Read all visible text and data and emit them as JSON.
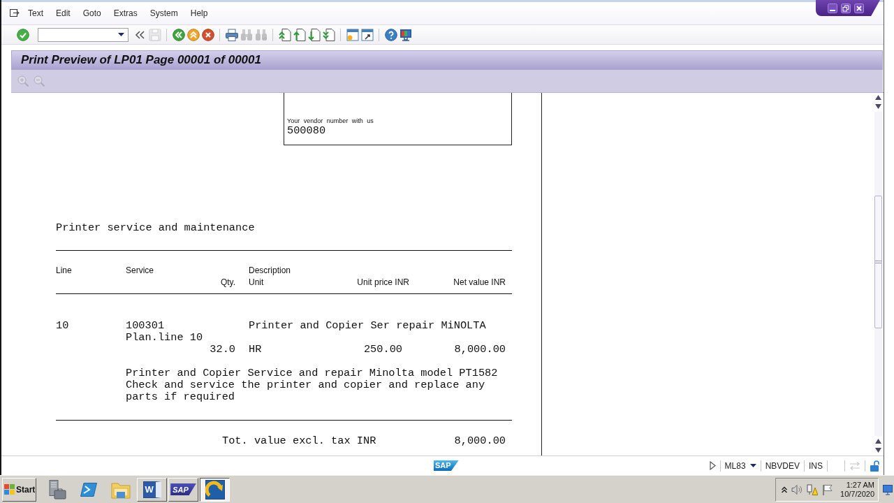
{
  "window": {
    "menu": [
      {
        "label": "Text"
      },
      {
        "label": "Edit"
      },
      {
        "label": "Goto"
      },
      {
        "label": "Extras"
      },
      {
        "label": "System"
      },
      {
        "label": "Help"
      }
    ]
  },
  "toolbar": {
    "buttons": [
      {
        "disabled": false
      },
      {
        "disabled": false
      },
      {
        "disabled": true
      },
      {
        "disabled": false
      },
      {
        "disabled": false
      },
      {
        "disabled": false
      },
      {
        "disabled": false
      },
      {
        "disabled": true
      },
      {
        "disabled": true
      },
      {
        "disabled": false
      },
      {
        "disabled": false
      },
      {
        "disabled": false
      },
      {
        "disabled": false
      },
      {
        "disabled": false
      },
      {
        "disabled": false
      },
      {
        "disabled": false
      },
      {
        "disabled": false
      }
    ]
  },
  "title": "Print Preview of LP01 Page 00001 of 00001",
  "application_toolbar": {
    "buttons": [
      {
        "disabled": true
      },
      {
        "disabled": true
      }
    ]
  },
  "document": {
    "vendor_box": {
      "label": "Your vendor number with us",
      "value": "500080"
    },
    "heading": "Printer service and maintenance",
    "header": {
      "line": "Line",
      "service": "Service",
      "description": "Description",
      "qty": "Qty.",
      "unit": "Unit",
      "unit_price": "Unit price INR",
      "net_value": "Net value INR"
    },
    "items": [
      {
        "line": "10",
        "service": "100301",
        "short_text": "Printer and Copier Ser repair MiNOLTA",
        "plan_line": "Plan.line 10",
        "qty": "32.0",
        "unit": "HR",
        "unit_price": "250.00",
        "net_value": "8,000.00",
        "long_text": "Printer and Copier Service and repair Minolta model PT1582\nCheck and service the printer and copier and replace any\nparts if required"
      }
    ],
    "total": {
      "label": "Tot. value excl. tax INR",
      "value": "8,000.00"
    }
  },
  "status_bar": {
    "logo": "SAP",
    "transaction": "ML83",
    "system": "NBVDEV",
    "mode": "INS"
  },
  "taskbar": {
    "start": "Start",
    "windows": [
      {
        "kind": "document",
        "logo": "W",
        "selected": false
      },
      {
        "kind": "banner",
        "logo": "SAP",
        "selected": false
      },
      {
        "kind": "arrow",
        "selected": true
      }
    ],
    "clock": {
      "time": "1:27 AM",
      "date": "10/7/2020"
    }
  }
}
